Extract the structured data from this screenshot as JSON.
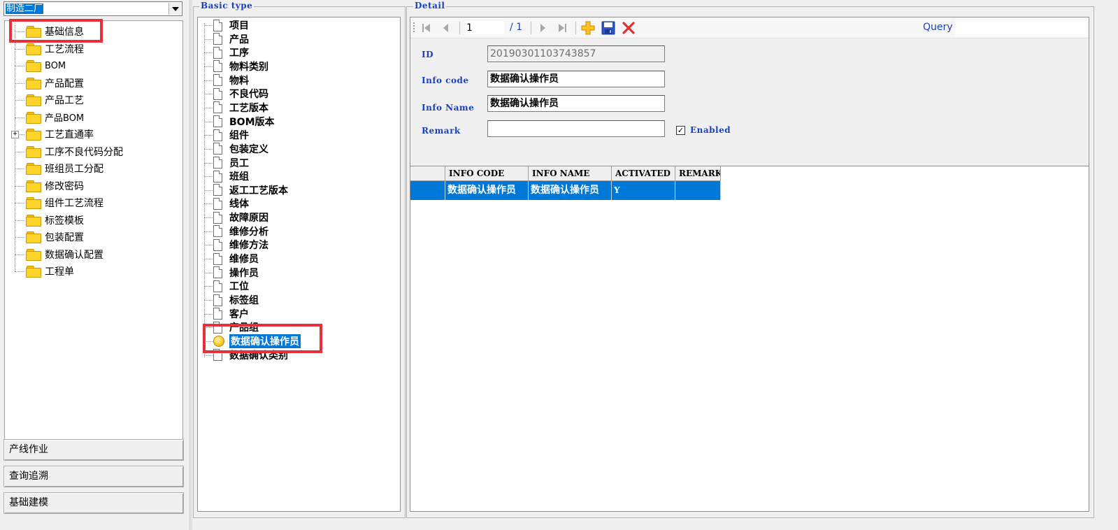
{
  "left": {
    "plant_select": "制造二厂",
    "tree": [
      {
        "label": "基础信息",
        "icon": "folder-icon"
      },
      {
        "label": "工艺流程",
        "icon": "folder-icon"
      },
      {
        "label": "BOM",
        "icon": "folder-icon"
      },
      {
        "label": "产品配置",
        "icon": "folder-icon"
      },
      {
        "label": "产品工艺",
        "icon": "folder-icon"
      },
      {
        "label": "产品BOM",
        "icon": "folder-icon"
      },
      {
        "label": "工艺直通率",
        "icon": "folder-icon",
        "expander": "+"
      },
      {
        "label": "工序不良代码分配",
        "icon": "folder-icon"
      },
      {
        "label": "班组员工分配",
        "icon": "folder-icon"
      },
      {
        "label": "修改密码",
        "icon": "folder-icon"
      },
      {
        "label": "组件工艺流程",
        "icon": "folder-icon"
      },
      {
        "label": "标签模板",
        "icon": "folder-icon"
      },
      {
        "label": "包装配置",
        "icon": "folder-icon"
      },
      {
        "label": "数据确认配置",
        "icon": "folder-icon"
      },
      {
        "label": "工程单",
        "icon": "folder-icon"
      }
    ],
    "nav_buttons": [
      "产线作业",
      "查询追溯",
      "基础建模"
    ]
  },
  "basic_type": {
    "legend": "Basic type",
    "items": [
      "项目",
      "产品",
      "工序",
      "物料类别",
      "物料",
      "不良代码",
      "工艺版本",
      "BOM版本",
      "组件",
      "包装定义",
      "员工",
      "班组",
      "返工工艺版本",
      "线体",
      "故障原因",
      "维修分析",
      "维修方法",
      "维修员",
      "操作员",
      "工位",
      "标签组",
      "客户",
      "产品组",
      "数据确认操作员",
      "数据确认类别"
    ],
    "selected": "数据确认操作员"
  },
  "detail": {
    "legend": "Detail",
    "toolbar": {
      "page_value": "1",
      "page_total": "/ 1",
      "query_label": "Query",
      "icons": [
        "first-page-icon",
        "prev-page-icon",
        "next-page-icon",
        "last-page-icon",
        "add-icon",
        "save-icon",
        "delete-icon"
      ]
    },
    "form": {
      "id_label": "ID",
      "id_value": "20190301103743857",
      "code_label": "Info code",
      "code_value": "数据确认操作员",
      "name_label": "Info Name",
      "name_value": "数据确认操作员",
      "remark_label": "Remark",
      "remark_value": "",
      "enabled_label": "Enabled",
      "enabled_checked": true
    },
    "grid": {
      "columns": [
        "INFO CODE",
        "INFO NAME",
        "ACTIVATED",
        "REMARK"
      ],
      "rows": [
        [
          "数据确认操作员",
          "数据确认操作员",
          "Y",
          ""
        ]
      ]
    }
  },
  "colors": {
    "selection": "#0078d7",
    "label_blue": "#1a3fbf",
    "highlight_red": "#e8303a",
    "folder_yellow": "#ffd42a"
  }
}
